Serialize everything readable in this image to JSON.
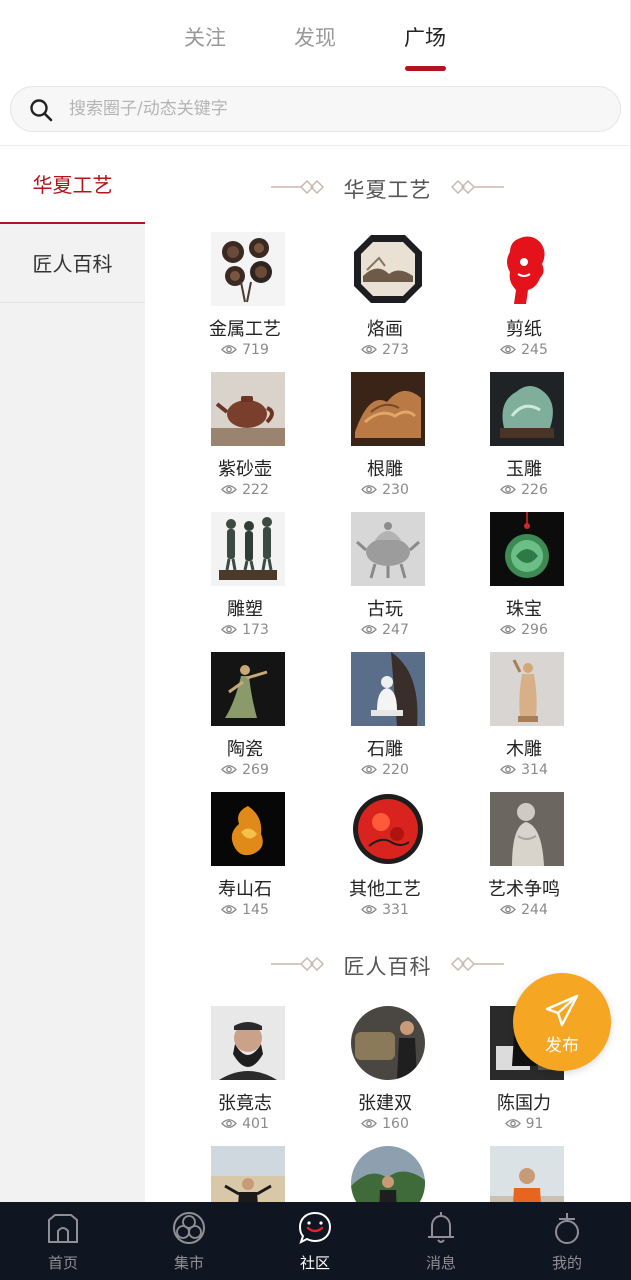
{
  "top_tabs": [
    {
      "label": "关注",
      "active": false
    },
    {
      "label": "发现",
      "active": false
    },
    {
      "label": "广场",
      "active": true
    }
  ],
  "search": {
    "placeholder": "搜索圈子/动态关键字"
  },
  "sidebar": {
    "items": [
      {
        "label": "华夏工艺",
        "active": true
      },
      {
        "label": "匠人百科",
        "active": false
      }
    ]
  },
  "sections": [
    {
      "title": "华夏工艺",
      "items": [
        {
          "name": "金属工艺",
          "views": "719",
          "thumb": "metal-roses"
        },
        {
          "name": "烙画",
          "views": "273",
          "thumb": "pyrography-frame"
        },
        {
          "name": "剪纸",
          "views": "245",
          "thumb": "papercut-portrait"
        },
        {
          "name": "紫砂壶",
          "views": "222",
          "thumb": "clay-teapot"
        },
        {
          "name": "根雕",
          "views": "230",
          "thumb": "root-carving"
        },
        {
          "name": "玉雕",
          "views": "226",
          "thumb": "jade-carving"
        },
        {
          "name": "雕塑",
          "views": "173",
          "thumb": "bronze-figures"
        },
        {
          "name": "古玩",
          "views": "247",
          "thumb": "silver-censer"
        },
        {
          "name": "珠宝",
          "views": "296",
          "thumb": "jade-pendant"
        },
        {
          "name": "陶瓷",
          "views": "269",
          "thumb": "ceramic-dancer"
        },
        {
          "name": "石雕",
          "views": "220",
          "thumb": "stone-buddha"
        },
        {
          "name": "木雕",
          "views": "314",
          "thumb": "wood-figure"
        },
        {
          "name": "寿山石",
          "views": "145",
          "thumb": "shoushan-stone"
        },
        {
          "name": "其他工艺",
          "views": "331",
          "thumb": "red-lacquer"
        },
        {
          "name": "艺术争鸣",
          "views": "244",
          "thumb": "marble-statue"
        }
      ]
    },
    {
      "title": "匠人百科",
      "items": [
        {
          "name": "张竟志",
          "views": "401",
          "thumb": "avatar-bearded-man"
        },
        {
          "name": "张建双",
          "views": "160",
          "thumb": "avatar-man-exhibit"
        },
        {
          "name": "陈国力",
          "views": "91",
          "thumb": "avatar-man-workshop"
        },
        {
          "name": "",
          "views": "",
          "thumb": "avatar-man-desert"
        },
        {
          "name": "",
          "views": "",
          "thumb": "avatar-man-field"
        },
        {
          "name": "",
          "views": "",
          "thumb": "avatar-man-orange"
        }
      ]
    }
  ],
  "fab": {
    "label": "发布",
    "icon": "send-icon"
  },
  "bottom_nav": [
    {
      "label": "首页",
      "icon": "home-icon",
      "active": false
    },
    {
      "label": "集市",
      "icon": "market-icon",
      "active": false
    },
    {
      "label": "社区",
      "icon": "community-icon",
      "active": true
    },
    {
      "label": "消息",
      "icon": "bell-icon",
      "active": false
    },
    {
      "label": "我的",
      "icon": "profile-icon",
      "active": false
    }
  ],
  "colors": {
    "accent": "#b3141b",
    "fab": "#f5a623",
    "nav_bg": "#101522",
    "sidebar_bg": "#f2f2f2"
  }
}
